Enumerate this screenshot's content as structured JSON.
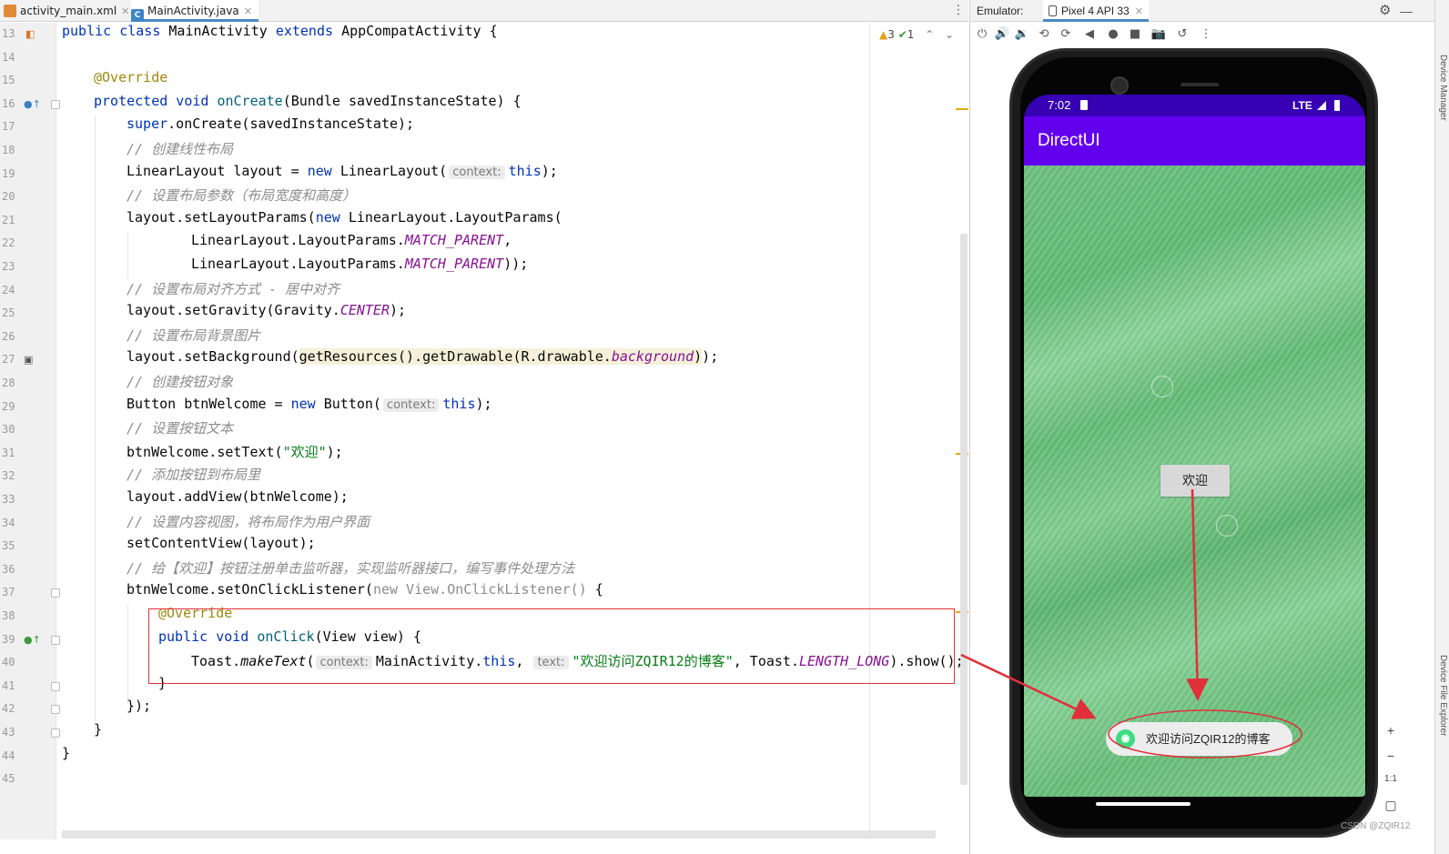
{
  "tabs": [
    {
      "label": "activity_main.xml",
      "icon": "xml-file-icon",
      "active": false
    },
    {
      "label": "MainActivity.java",
      "icon": "java-class-icon",
      "active": true
    }
  ],
  "inspections": {
    "warnings": "3",
    "weak_warnings": "1"
  },
  "editor": {
    "line_numbers": [
      "13",
      "14",
      "15",
      "16",
      "17",
      "18",
      "19",
      "20",
      "21",
      "22",
      "23",
      "24",
      "25",
      "26",
      "27",
      "28",
      "29",
      "30",
      "31",
      "32",
      "33",
      "34",
      "35",
      "36",
      "37",
      "38",
      "39",
      "40",
      "41",
      "42",
      "43",
      "44",
      "45"
    ],
    "code": {
      "l13": {
        "a": "public class ",
        "b": "MainActivity ",
        "c": "extends ",
        "d": "AppCompatActivity {"
      },
      "l15": "@Override",
      "l16": {
        "a": "protected void ",
        "b": "onCreate",
        "c": "(Bundle savedInstanceState) {"
      },
      "l17": {
        "a": "super",
        "b": ".onCreate(savedInstanceState);"
      },
      "l18": "// 创建线性布局",
      "l19": {
        "a": "LinearLayout layout = ",
        "b": "new ",
        "c": "LinearLayout(",
        "hint": "context:",
        "d": "this",
        "e": ");"
      },
      "l20": "// 设置布局参数（布局宽度和高度）",
      "l21": {
        "a": "layout.setLayoutParams(",
        "b": "new ",
        "c": "LinearLayout.LayoutParams("
      },
      "l22": {
        "a": "LinearLayout.LayoutParams.",
        "b": "MATCH_PARENT",
        "c": ","
      },
      "l23": {
        "a": "LinearLayout.LayoutParams.",
        "b": "MATCH_PARENT",
        "c": "));"
      },
      "l24": "// 设置布局对齐方式 - 居中对齐",
      "l25": {
        "a": "layout.setGravity(Gravity.",
        "b": "CENTER",
        "c": ");"
      },
      "l26": "// 设置布局背景图片",
      "l27": {
        "a": "layout.setBackground(",
        "b": "getResources().getDrawable(R.drawable.",
        "c": "background",
        "d": ")",
        "e": ");"
      },
      "l28": "// 创建按钮对象",
      "l29": {
        "a": "Button btnWelcome = ",
        "b": "new ",
        "c": "Button(",
        "hint": "context:",
        "d": "this",
        "e": ");"
      },
      "l30": "// 设置按钮文本",
      "l31": {
        "a": "btnWelcome.setText(",
        "b": "\"欢迎\"",
        "c": ");"
      },
      "l32": "// 添加按钮到布局里",
      "l33": "layout.addView(btnWelcome);",
      "l34": "// 设置内容视图，将布局作为用户界面",
      "l35": "setContentView(layout);",
      "l36": "// 给【欢迎】按钮注册单击监听器，实现监听器接口，编写事件处理方法",
      "l37": {
        "a": "btnWelcome.setOnClickListener(",
        "b": "new View.OnClickListener()",
        "c": " {"
      },
      "l38": "@Override",
      "l39": {
        "a": "public void ",
        "b": "onClick",
        "c": "(View view) {"
      },
      "l40": {
        "a": "Toast.",
        "b": "makeText",
        "c": "(",
        "hint1": "context:",
        "d": "MainActivity.",
        "e": "this",
        "f": ",",
        "hint2": "text:",
        "g": "\"欢迎访问ZQIR12的博客\"",
        "h": ", Toast.",
        "i": "LENGTH_LONG",
        "j": ").show();"
      },
      "l41": "}",
      "l42": "});",
      "l43": "}",
      "l44": "}"
    }
  },
  "emulator": {
    "label": "Emulator:",
    "device_tab": "Pixel 4 API 33",
    "status_time": "7:02",
    "status_network": "LTE",
    "app_title": "DirectUI",
    "button_text": "欢迎",
    "toast_text": "欢迎访问ZQIR12的博客",
    "zoom_in": "+",
    "zoom_out": "−",
    "zoom_actual": "1:1"
  },
  "colors": {
    "app_bar": "#6200ee",
    "status_bar": "#3700b3",
    "annotation_red": "#e0303a",
    "toast_icon": "#3ddc84"
  },
  "watermark": "CSDN @ZQIR12"
}
